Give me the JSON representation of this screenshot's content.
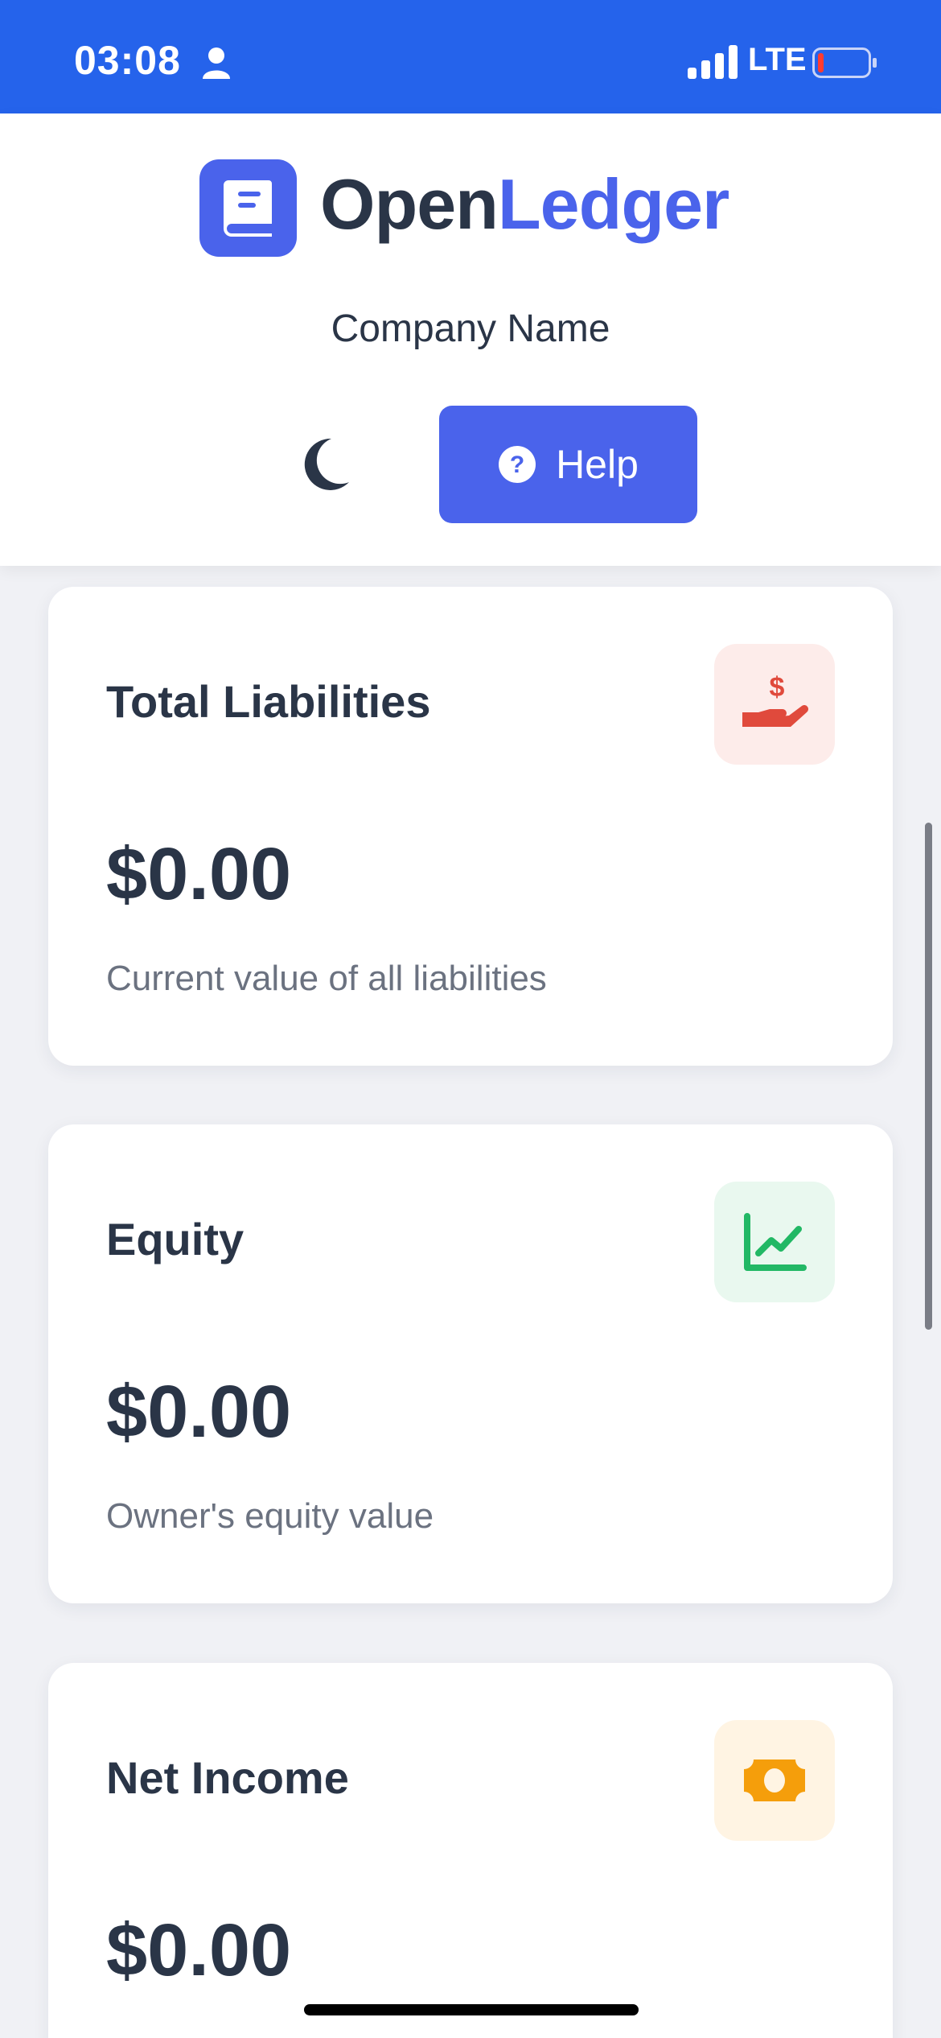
{
  "status_bar": {
    "time": "03:08",
    "network": "LTE",
    "icons": [
      "person-icon",
      "signal-icon",
      "battery-icon"
    ],
    "background": "#2563eb"
  },
  "header": {
    "brand_part1": "Open",
    "brand_part2": "Ledger",
    "logo_icon": "book-icon",
    "company_name": "Company Name",
    "theme_toggle_icon": "moon-icon",
    "help_label": "Help",
    "help_icon": "question-circle-icon",
    "accent": "#4a63eb"
  },
  "cards": [
    {
      "title": "Total Liabilities",
      "value": "$0.00",
      "description": "Current value of all liabilities",
      "icon": "hand-dollar-icon",
      "icon_color": "#e04a3c",
      "icon_bg": "#fdecea"
    },
    {
      "title": "Equity",
      "value": "$0.00",
      "description": "Owner's equity value",
      "icon": "line-chart-icon",
      "icon_color": "#22b865",
      "icon_bg": "#e9f8ef"
    },
    {
      "title": "Net Income",
      "value": "$0.00",
      "description": "",
      "icon": "money-bill-icon",
      "icon_color": "#f59e0b",
      "icon_bg": "#fff4e3"
    }
  ]
}
